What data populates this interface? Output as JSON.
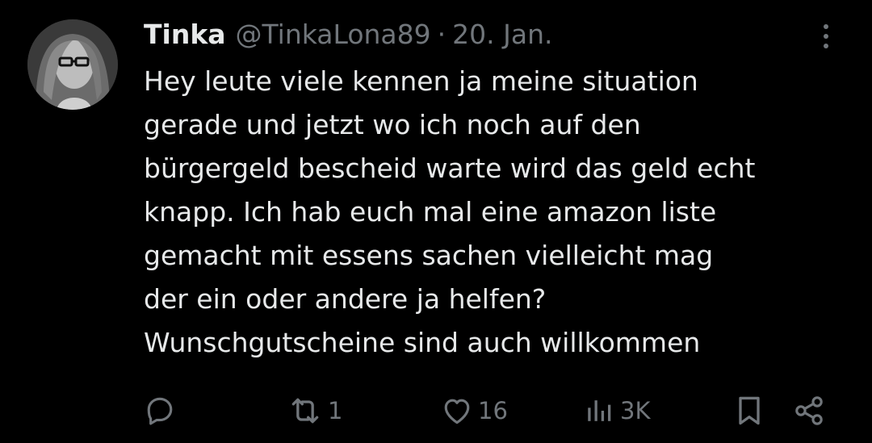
{
  "tweet": {
    "author_name": "Tinka",
    "author_handle": "@TinkaLona89",
    "separator": "·",
    "date": "20. Jan.",
    "text": "Hey leute viele kennen ja meine situation\ngerade und jetzt wo ich noch auf den\nbürgergeld bescheid warte wird das geld echt\nknapp. Ich hab euch mal eine amazon liste\ngemacht mit essens sachen vielleicht mag\nder ein oder andere ja helfen?\nWunschgutscheine sind auch willkommen"
  },
  "actions": {
    "reply_count": "",
    "retweet_count": "1",
    "like_count": "16",
    "view_count": "3K"
  },
  "icons": {
    "reply": "reply-icon",
    "retweet": "retweet-icon",
    "like": "heart-icon",
    "views": "views-icon",
    "bookmark": "bookmark-icon",
    "share": "share-icon",
    "more": "more-icon"
  },
  "colors": {
    "background": "#000000",
    "text": "#e7e9ea",
    "muted": "#71767b"
  }
}
